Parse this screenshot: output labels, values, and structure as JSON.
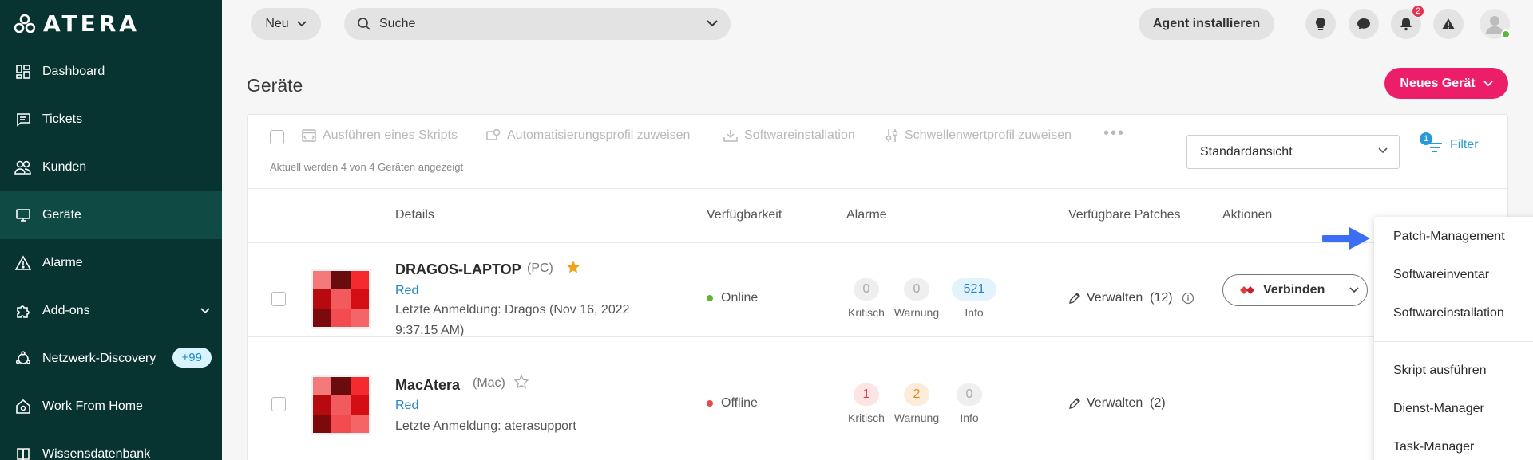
{
  "brand": {
    "logo_text": "ATERA"
  },
  "sidebar": {
    "items": [
      {
        "label": "Dashboard",
        "icon": "dashboard-grid-icon"
      },
      {
        "label": "Tickets",
        "icon": "ticket-chat-icon"
      },
      {
        "label": "Kunden",
        "icon": "customers-icon"
      },
      {
        "label": "Geräte",
        "icon": "monitor-icon",
        "active": true
      },
      {
        "label": "Alarme",
        "icon": "warning-triangle-icon"
      },
      {
        "label": "Add-ons",
        "icon": "puzzle-icon"
      },
      {
        "label": "Netzwerk-Discovery",
        "icon": "network-icon",
        "badge": "+99"
      },
      {
        "label": "Work From Home",
        "icon": "home-icon"
      },
      {
        "label": "Wissensdatenbank",
        "icon": "book-icon"
      }
    ]
  },
  "topbar": {
    "new_label": "Neu",
    "search_placeholder": "Suche",
    "agent_label": "Agent installieren",
    "notification_count": "2"
  },
  "page": {
    "title": "Geräte",
    "new_device_label": "Neues Gerät"
  },
  "toolbar": {
    "actions": [
      "Ausführen eines Skripts",
      "Automatisierungsprofil zuweisen",
      "Softwareinstallation",
      "Schwellenwertprofil zuweisen"
    ],
    "status": "Aktuell werden 4 von 4 Geräten angezeigt",
    "view_select": "Standardansicht",
    "filter_label": "Filter",
    "filter_count": "1"
  },
  "table": {
    "headers": [
      "Details",
      "Verfügbarkeit",
      "Alarme",
      "Verfügbare Patches",
      "Aktionen"
    ],
    "alarm_labels": [
      "Kritisch",
      "Warnung",
      "Info"
    ],
    "rows": [
      {
        "name": "DRAGOS-LAPTOP",
        "type": "(PC)",
        "starred": true,
        "tag": "Red",
        "login_line1": "Letzte Anmeldung: Dragos (Nov 16, 2022",
        "login_line2": "9:37:15 AM)",
        "availability": "Online",
        "alarms": [
          "0",
          "0",
          "521"
        ],
        "patches": "Verwalten  (12)",
        "connect_label": "Verbinden"
      },
      {
        "name": "MacAtera",
        "type": "(Mac)",
        "starred": false,
        "tag": "Red",
        "login_line1": "Letzte Anmeldung: aterasupport",
        "availability": "Offline",
        "alarms": [
          "1",
          "2",
          "0"
        ],
        "patches": "Verwalten  (2)"
      }
    ]
  },
  "dropdown": {
    "items": [
      "Patch-Management",
      "Softwareinventar",
      "Softwareinstallation",
      "Skript ausführen",
      "Dienst-Manager",
      "Task-Manager"
    ]
  },
  "colors": {
    "sidebar_bg": "#073430",
    "accent_pink": "#ec1e6a",
    "link_blue": "#2a86c9",
    "online": "#5bb73b",
    "offline": "#e5484d"
  }
}
